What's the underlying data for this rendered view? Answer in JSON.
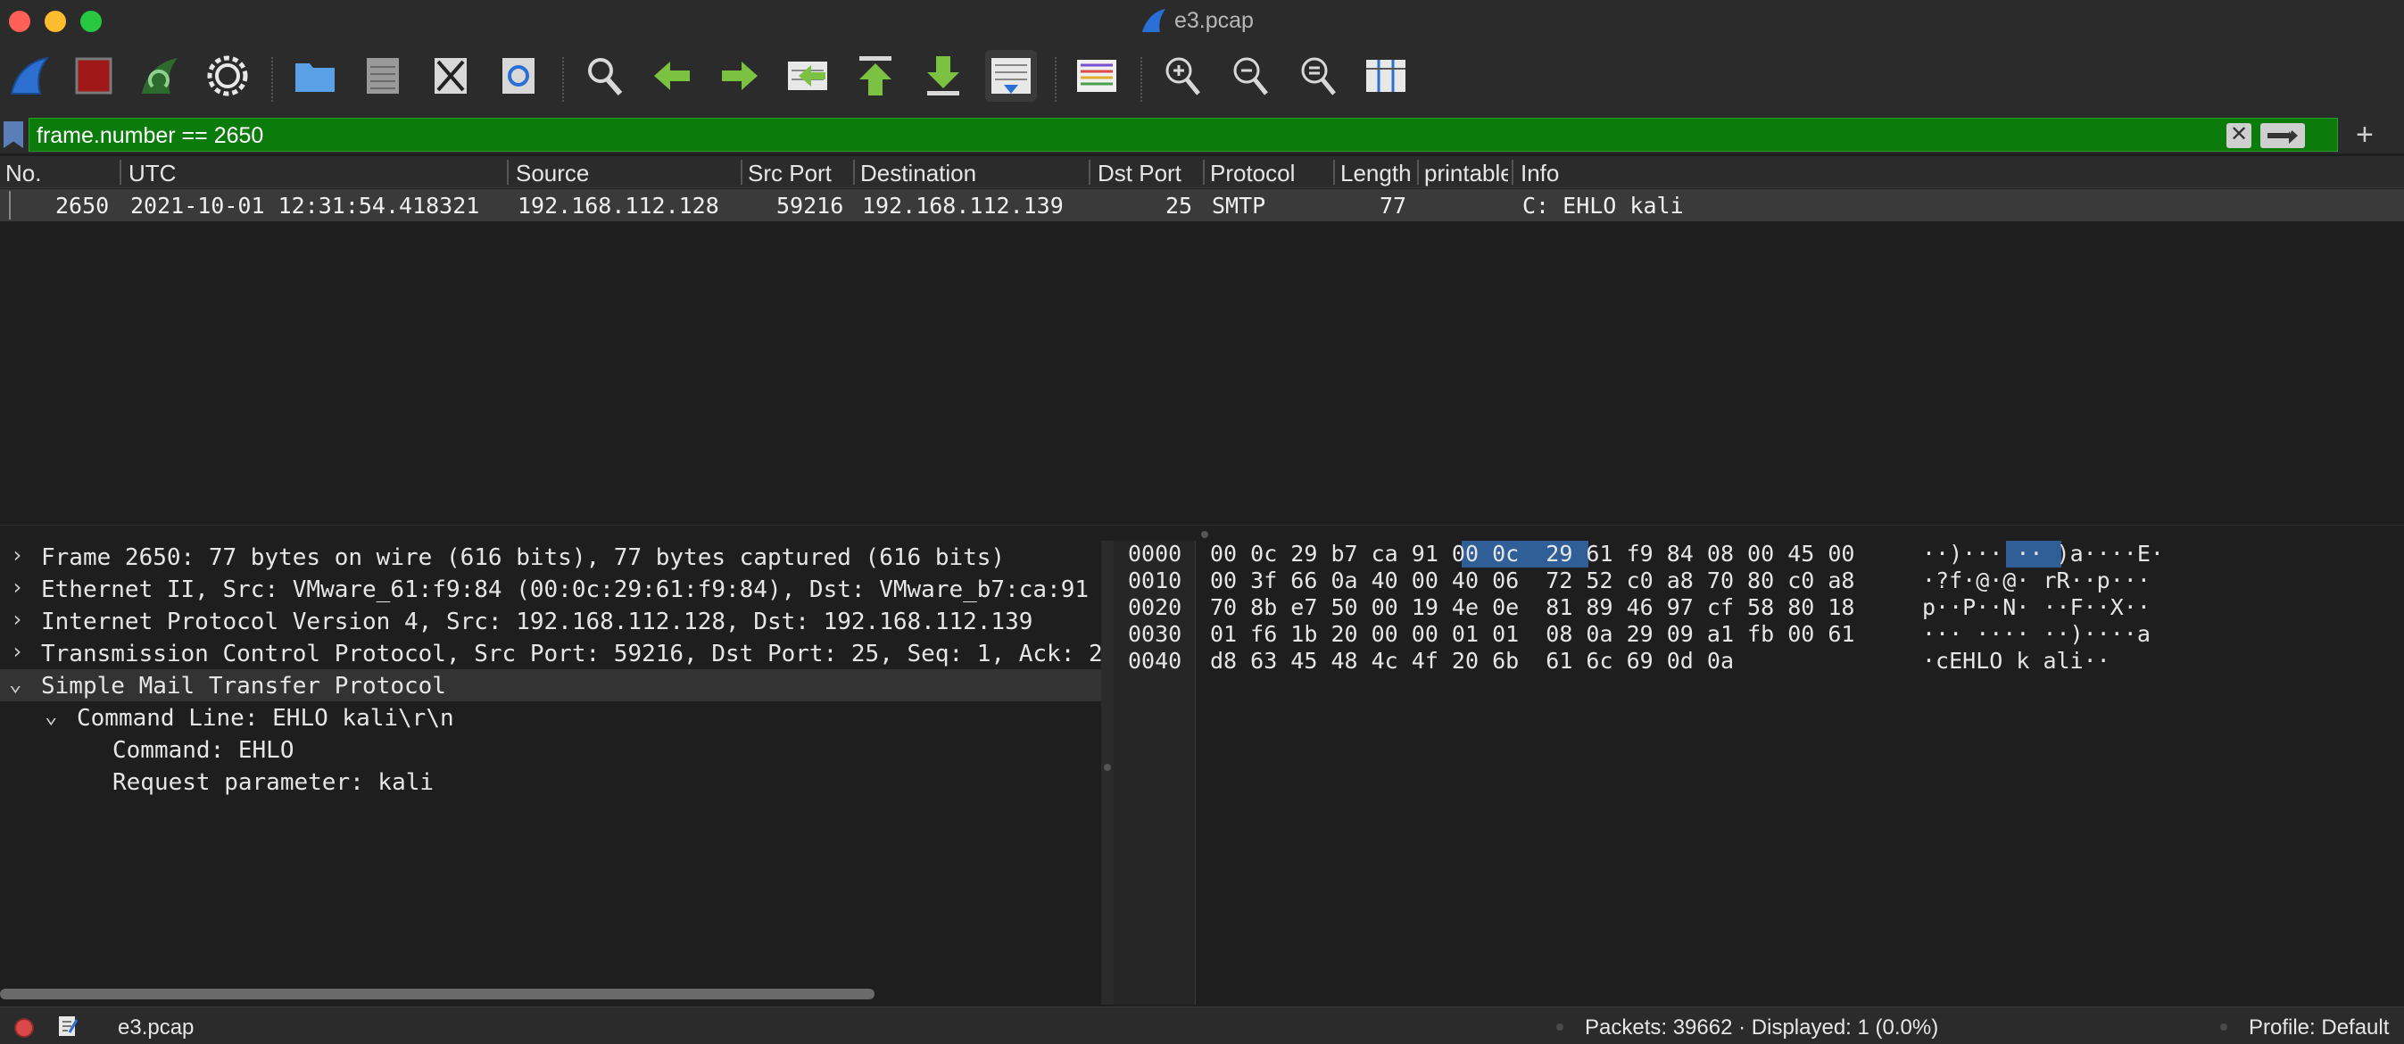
{
  "window": {
    "title": "e3.pcap"
  },
  "toolbar": {
    "buttons": [
      "start-capture",
      "stop-capture",
      "restart-capture",
      "capture-options",
      "open-file",
      "save-file",
      "close-file",
      "reload-file",
      "find-packet",
      "go-back",
      "go-forward",
      "go-to-packet",
      "go-first",
      "go-last",
      "auto-scroll",
      "colorize",
      "zoom-in",
      "zoom-out",
      "zoom-normal",
      "resize-columns"
    ]
  },
  "filter": {
    "value": "frame.number == 2650"
  },
  "packet_list": {
    "columns": [
      "No.",
      "UTC",
      "Source",
      "Src Port",
      "Destination",
      "Dst Port",
      "Protocol",
      "Length",
      "printable",
      "Info"
    ],
    "rows": [
      {
        "no": "2650",
        "utc": "2021-10-01 12:31:54.418321",
        "source": "192.168.112.128",
        "src_port": "59216",
        "destination": "192.168.112.139",
        "dst_port": "25",
        "protocol": "SMTP",
        "length": "77",
        "printable": "",
        "info": "C: EHLO kali"
      }
    ]
  },
  "details": {
    "lines": [
      {
        "arrow": "›",
        "text": "Frame 2650: 77 bytes on wire (616 bits), 77 bytes captured (616 bits)"
      },
      {
        "arrow": "›",
        "text": "Ethernet II, Src: VMware_61:f9:84 (00:0c:29:61:f9:84), Dst: VMware_b7:ca:91"
      },
      {
        "arrow": "›",
        "text": "Internet Protocol Version 4, Src: 192.168.112.128, Dst: 192.168.112.139"
      },
      {
        "arrow": "›",
        "text": "Transmission Control Protocol, Src Port: 59216, Dst Port: 25, Seq: 1, Ack: 2"
      },
      {
        "arrow": "⌄",
        "text": "Simple Mail Transfer Protocol"
      },
      {
        "arrow": "⌄",
        "text": "Command Line: EHLO kali\\r\\n"
      },
      {
        "arrow": "",
        "text": "Command: EHLO"
      },
      {
        "arrow": "",
        "text": "Request parameter: kali"
      }
    ]
  },
  "bytes": {
    "rows": [
      {
        "offset": "0000",
        "hex": "00 0c 29 b7 ca 91 00 0c  29 61 f9 84 08 00 45 00",
        "ascii": "··)··· ·· )a····E·"
      },
      {
        "offset": "0010",
        "hex": "00 3f 66 0a 40 00 40 06  72 52 c0 a8 70 80 c0 a8",
        "ascii": "·?f·@·@· rR··p···"
      },
      {
        "offset": "0020",
        "hex": "70 8b e7 50 00 19 4e 0e  81 89 46 97 cf 58 80 18",
        "ascii": "p··P··N· ··F··X··"
      },
      {
        "offset": "0030",
        "hex": "01 f6 1b 20 00 00 01 01  08 0a 29 09 a1 fb 00 61",
        "ascii": "··· ···· ··)····a"
      },
      {
        "offset": "0040",
        "hex": "d8 63 45 48 4c 4f 20 6b  61 6c 69 0d 0a",
        "ascii": "·cEHLO k ali··"
      }
    ]
  },
  "status": {
    "file": "e3.pcap",
    "packets": "Packets: 39662 · Displayed: 1 (0.0%)",
    "profile": "Profile: Default"
  },
  "colors": {
    "filter_bg": "#0b7b0b",
    "selection": "#2f5f96",
    "bg": "#1e1e1e",
    "chrome": "#2b2b2b"
  }
}
